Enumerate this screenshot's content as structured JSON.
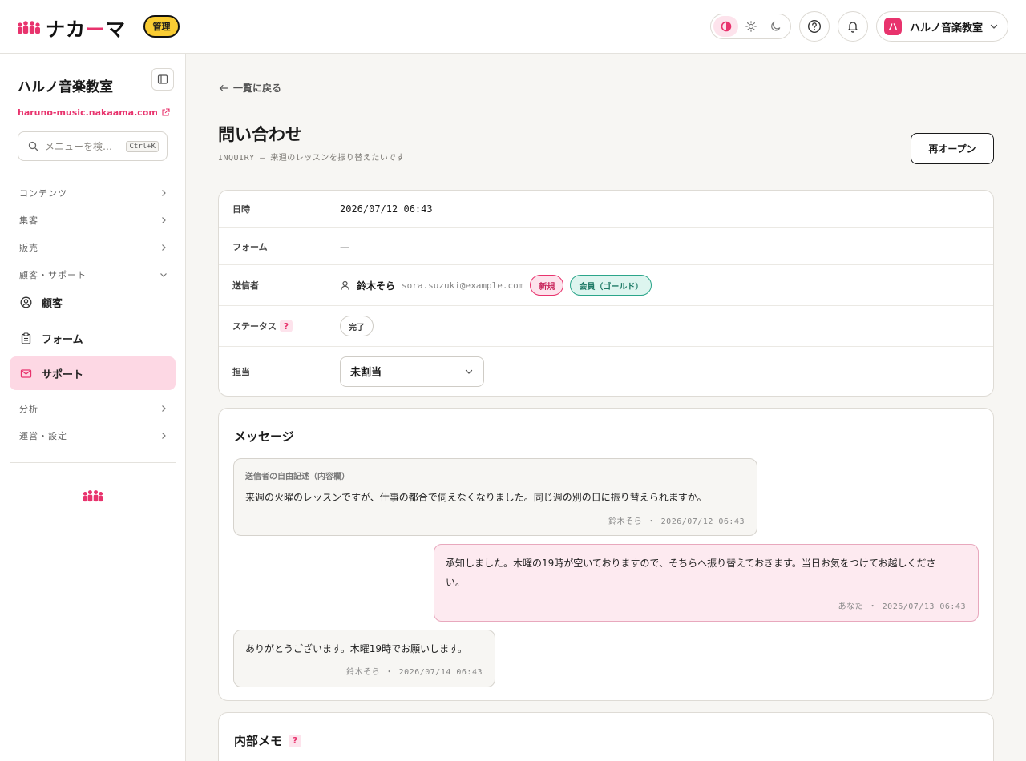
{
  "brand": {
    "name_a": "ナカ",
    "name_b": "ー",
    "name_c": "マ",
    "badge": "管理",
    "accent": "#e8336d"
  },
  "topbar": {
    "account_initial": "ハ",
    "account_name": "ハルノ音楽教室"
  },
  "sidebar": {
    "title": "ハルノ音楽教室",
    "url": "haruno-music.nakaama.com",
    "search_placeholder": "メニューを検…",
    "search_shortcut": "Ctrl+K",
    "groups": {
      "contents": "コンテンツ",
      "marketing": "集客",
      "sales": "販売",
      "customer_support": "顧客・サポート",
      "analytics": "分析",
      "operations": "運営・設定"
    },
    "items": {
      "customers": "顧客",
      "forms": "フォーム",
      "support": "サポート"
    }
  },
  "main": {
    "back_label": "一覧に戻る",
    "title": "問い合わせ",
    "subtitle": "INQUIRY — 来週のレッスンを振り替えたいです",
    "reopen_label": "再オープン",
    "info": {
      "datetime_label": "日時",
      "datetime_value": "2026/07/12 06:43",
      "form_label": "フォーム",
      "form_value": "—",
      "sender_label": "送信者",
      "sender_name": "鈴木そら",
      "sender_email": "sora.suzuki@example.com",
      "badge_new": "新規",
      "badge_member": "会員（ゴールド）",
      "status_label": "ステータス",
      "status_value": "完了",
      "assignee_label": "担当",
      "assignee_value": "未割当"
    },
    "messages": {
      "title": "メッセージ",
      "list": [
        {
          "head": "送信者の自由記述（内容欄）",
          "text": "来週の火曜のレッスンですが、仕事の都合で伺えなくなりました。同じ週の別の日に振り替えられますか。",
          "meta": "鈴木そら ・ 2026/07/12 06:43"
        },
        {
          "text_1": "承知しました。木曜の19時が空いておりますので、そちらへ振り替えておきます。当日お気をつけてお越しくださ",
          "text_2": "い。",
          "meta": "あなた ・ 2026/07/13 06:43"
        },
        {
          "text": "ありがとうございます。木曜19時でお願いします。",
          "meta": "鈴木そら ・ 2026/07/14 06:43"
        }
      ]
    },
    "memo": {
      "title": "内部メモ"
    },
    "help_mark": "?"
  }
}
